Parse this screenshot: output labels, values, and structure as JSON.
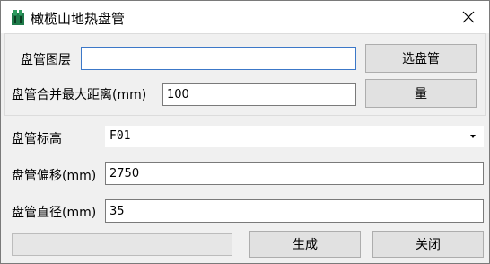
{
  "window": {
    "title": "橄榄山地热盘管"
  },
  "form": {
    "layer_label": "盘管图层",
    "layer_value": "",
    "select_button": "选盘管",
    "merge_label": "盘管合并最大距离(mm)",
    "merge_value": "100",
    "measure_button": "量",
    "elevation_label": "盘管标高",
    "elevation_value": "F01",
    "offset_label": "盘管偏移(mm)",
    "offset_value": "2750",
    "diameter_label": "盘管直径(mm)",
    "diameter_value": "35"
  },
  "footer": {
    "progress": 0,
    "generate_button": "生成",
    "close_button": "关闭"
  }
}
